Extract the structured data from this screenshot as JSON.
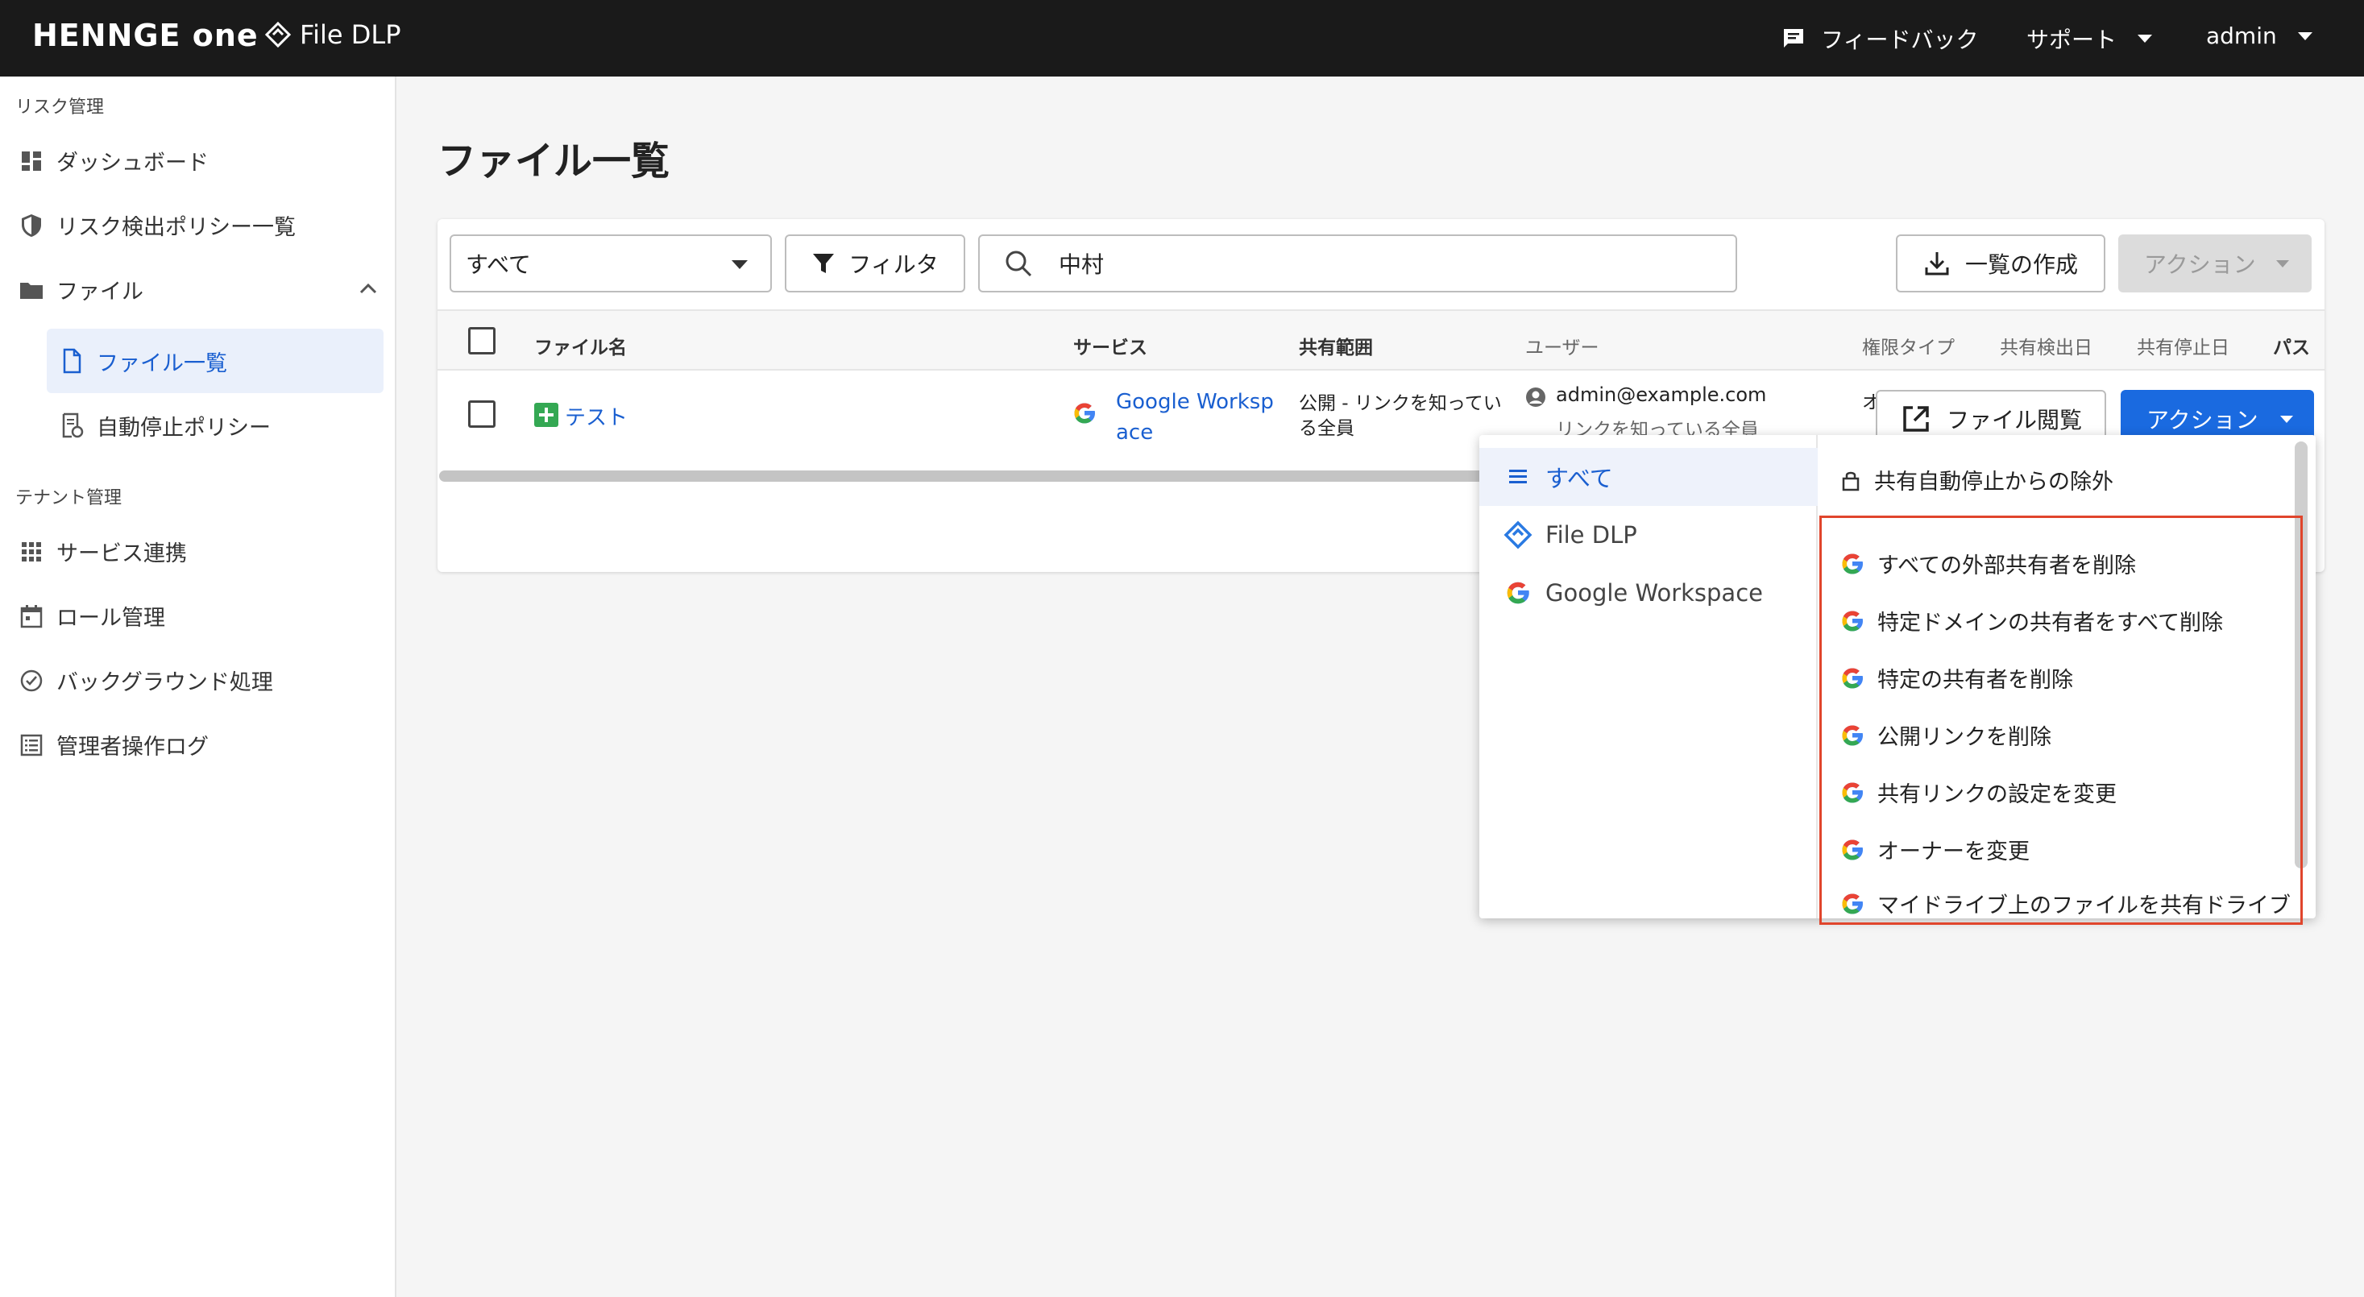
{
  "topbar": {
    "logo": "HENNGE one",
    "product": "File DLP",
    "feedback": "フィードバック",
    "support": "サポート",
    "user": "admin"
  },
  "sidebar": {
    "section_risk": "リスク管理",
    "dashboard": "ダッシュボード",
    "policy_list": "リスク検出ポリシー一覧",
    "files": "ファイル",
    "file_list": "ファイル一覧",
    "auto_stop": "自動停止ポリシー",
    "section_tenant": "テナント管理",
    "service_link": "サービス連携",
    "role": "ロール管理",
    "background": "バックグラウンド処理",
    "audit_log": "管理者操作ログ"
  },
  "main": {
    "title": "ファイル一覧",
    "scope_value": "すべて",
    "filter_label": "フィルタ",
    "search_value": "中村",
    "export_label": "一覧の作成",
    "action_label": "アクション"
  },
  "table": {
    "headers": {
      "name": "ファイル名",
      "service": "サービス",
      "scope": "共有範囲",
      "user": "ユーザー",
      "perm": "権限タイプ",
      "detected": "共有検出日",
      "stopped": "共有停止日",
      "path": "パス"
    },
    "row": {
      "name": "テスト",
      "service_line1": "Google Worksp",
      "service_line2": "ace",
      "scope_line1": "公開 - リンクを知ってい",
      "scope_line2": "る全員",
      "user_email": "admin@example.com",
      "user_link": "リンクを知っている全員",
      "perm_part": "オ",
      "view_btn": "ファイル閲覧",
      "action_btn": "アクション"
    }
  },
  "dropdown": {
    "categories": [
      "すべて",
      "File DLP",
      "Google Workspace"
    ],
    "exclude": "共有自動停止からの除外",
    "actions": [
      "すべての外部共有者を削除",
      "特定ドメインの共有者をすべて削除",
      "特定の共有者を削除",
      "公開リンクを削除",
      "共有リンクの設定を変更",
      "オーナーを変更",
      "マイドライブ上のファイルを共有ドライブ"
    ]
  },
  "colors": {
    "topbar": "#1a1a1a",
    "accent": "#1a6ae0",
    "highlight": "#e0452c"
  }
}
